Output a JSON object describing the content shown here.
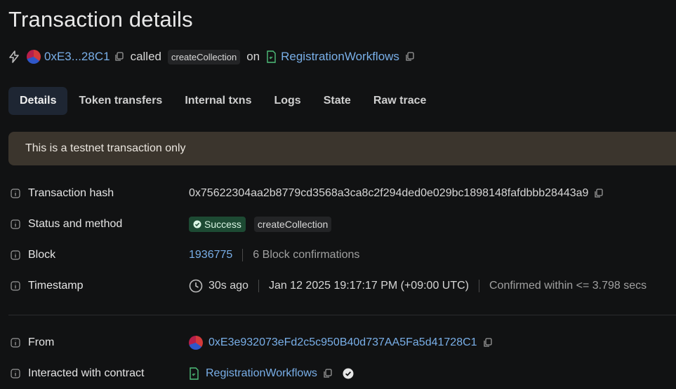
{
  "page": {
    "title": "Transaction details"
  },
  "summary": {
    "from_short": "0xE3...28C1",
    "called_text": "called",
    "method": "createCollection",
    "on_text": "on",
    "contract_name": "RegistrationWorkflows"
  },
  "tabs": [
    {
      "label": "Details",
      "active": true
    },
    {
      "label": "Token transfers",
      "active": false
    },
    {
      "label": "Internal txns",
      "active": false
    },
    {
      "label": "Logs",
      "active": false
    },
    {
      "label": "State",
      "active": false
    },
    {
      "label": "Raw trace",
      "active": false
    }
  ],
  "alert": {
    "text": "This is a testnet transaction only"
  },
  "details": {
    "tx_hash": {
      "label": "Transaction hash",
      "value": "0x75622304aa2b8779cd3568a3ca8c2f294ded0e029bc1898148fafdbbb28443a9"
    },
    "status": {
      "label": "Status and method",
      "status": "Success",
      "method": "createCollection"
    },
    "block": {
      "label": "Block",
      "number": "1936775",
      "confirmations": "6 Block confirmations"
    },
    "timestamp": {
      "label": "Timestamp",
      "relative": "30s ago",
      "absolute": "Jan 12 2025 19:17:17 PM (+09:00 UTC)",
      "confirmed": "Confirmed within <= 3.798 secs"
    },
    "from": {
      "label": "From",
      "address": "0xE3e932073eFd2c5c950B40d737AA5Fa5d41728C1"
    },
    "contract": {
      "label": "Interacted with contract",
      "name": "RegistrationWorkflows"
    }
  },
  "colors": {
    "link": "#79afe8",
    "success_bg": "#1d4a33",
    "alert_bg": "#3b352d",
    "active_tab_bg": "#1e2633"
  }
}
